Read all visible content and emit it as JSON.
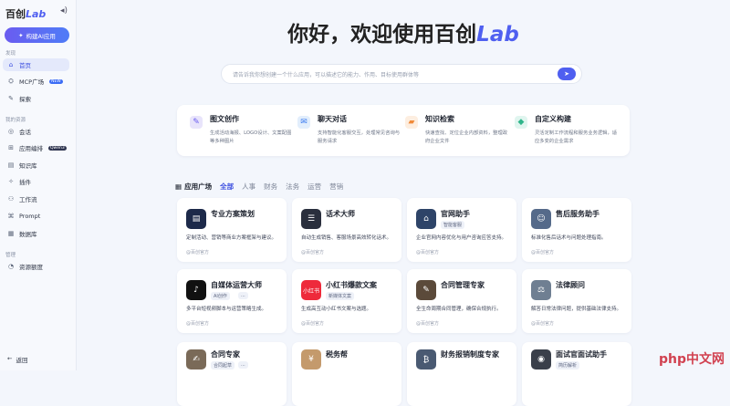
{
  "brand": {
    "name": "百创",
    "suffix": "Lab"
  },
  "sidebar": {
    "build_button": "构建AI应用",
    "groups": {
      "discover": "发现",
      "mine": "我的资源",
      "manage": "管理"
    },
    "discover_items": [
      {
        "label": "首页",
        "icon": "home-icon"
      },
      {
        "label": "MCP广场",
        "icon": "mcp-icon",
        "badge": "NEW"
      }
    ],
    "explore": {
      "label": "探索",
      "icon": "explore-icon"
    },
    "mine_items": [
      {
        "label": "会话",
        "icon": "chat-icon"
      },
      {
        "label": "应用编排",
        "icon": "app-icon",
        "badge": "Qwen3"
      },
      {
        "label": "知识库",
        "icon": "knowledge-icon"
      },
      {
        "label": "插件",
        "icon": "plugin-icon"
      },
      {
        "label": "工作流",
        "icon": "workflow-icon"
      },
      {
        "label": "Prompt",
        "icon": "prompt-icon"
      },
      {
        "label": "数据库",
        "icon": "database-icon"
      }
    ],
    "manage_items": [
      {
        "label": "资源额度",
        "icon": "quota-icon"
      }
    ],
    "back": "返回"
  },
  "hero": {
    "title_prefix": "你好，欢迎使用百创",
    "title_lab": "Lab"
  },
  "search": {
    "placeholder": "请告诉我你想创建一个什么应用，可以描述它的能力、作用、目标使用群体等"
  },
  "features": [
    {
      "title": "图文创作",
      "desc": "生成活动海报、LOGO设计、文案配图等多种图片",
      "icon": "paint-icon",
      "color": "#e8e4fb"
    },
    {
      "title": "聊天对话",
      "desc": "支持智能化客服交互，处理常见咨询与服务请求",
      "icon": "chat-bubble-icon",
      "color": "#e2eefc"
    },
    {
      "title": "知识检索",
      "desc": "快速查找、定位企业内部资料，整理政府企业文件",
      "icon": "folder-icon",
      "color": "#fdeee0"
    },
    {
      "title": "自定义构建",
      "desc": "灵活定制工作流程和服务业务逻辑，适应多变的企业需求",
      "icon": "build-icon",
      "color": "#e0f5ef"
    }
  ],
  "tabs": {
    "plaza": "应用广场",
    "items": [
      "全部",
      "人事",
      "财务",
      "法务",
      "运营",
      "营销"
    ]
  },
  "cards": [
    {
      "title": "专业方案策划",
      "desc": "定制活动、营销等商业方案框架与建议。",
      "source": "@百创官方",
      "icon_bg": "#1d2a4a",
      "icon_text": "▤"
    },
    {
      "title": "话术大师",
      "desc": "自动生成销售、客服场景高效转化话术。",
      "source": "@百创官方",
      "icon_bg": "#2a2f3d",
      "icon_text": "☰"
    },
    {
      "title": "官网助手",
      "tag": "智能客服",
      "desc": "企业官网内容优化与用户咨询应答支持。",
      "source": "@百创官方",
      "icon_bg": "#2e4468",
      "icon_text": "⌂"
    },
    {
      "title": "售后服务助手",
      "desc": "标准化售后话术与问题处理指南。",
      "source": "@百创官方",
      "icon_bg": "#556a8a",
      "icon_text": "☺"
    },
    {
      "title": "自媒体运营大师",
      "tag": "AI创作",
      "tag2": "...",
      "desc": "多平台短视频脚本与运营策略生成。",
      "source": "@百创官方",
      "icon_bg": "#111111",
      "icon_text": "♪"
    },
    {
      "title": "小红书爆款文案",
      "tag": "新媒体文案",
      "desc": "生成高互动小红书文案与选题。",
      "source": "@百创官方",
      "icon_bg": "#ee2a3b",
      "icon_text": "小红书"
    },
    {
      "title": "合同管理专家",
      "desc": "全生命周期合同管理，确保合规执行。",
      "source": "@百创官方",
      "icon_bg": "#5b4a3a",
      "icon_text": "✎"
    },
    {
      "title": "法律顾问",
      "desc": "解答日常法律问题，提供基础法律支持。",
      "source": "@百创官方",
      "icon_bg": "#6f7f92",
      "icon_text": "⚖"
    },
    {
      "title": "合同专家",
      "tag": "合同起草",
      "tag2": "...",
      "desc": "",
      "source": "",
      "icon_bg": "#7a6a58",
      "icon_text": "✍"
    },
    {
      "title": "税务帮",
      "desc": "",
      "source": "",
      "icon_bg": "#c49a6c",
      "icon_text": "¥"
    },
    {
      "title": "财务报销制度专家",
      "desc": "",
      "source": "",
      "icon_bg": "#4a5a72",
      "icon_text": "₿"
    },
    {
      "title": "面试官面试助手",
      "tag": "简历解析",
      "desc": "",
      "source": "",
      "icon_bg": "#3a3f4a",
      "icon_text": "◉"
    }
  ],
  "watermark": "php中文网"
}
